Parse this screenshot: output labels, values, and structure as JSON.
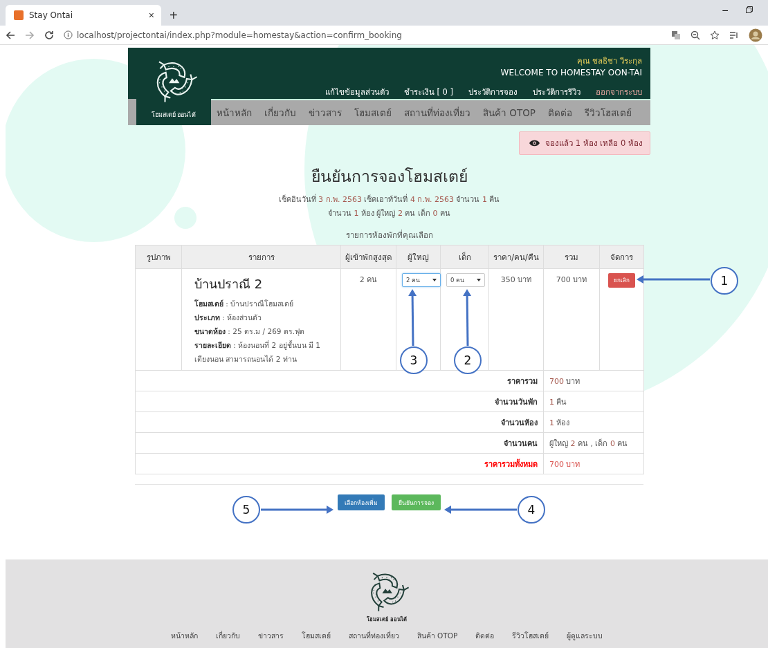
{
  "browser": {
    "tab_title": "Stay Ontai",
    "tab_close": "×",
    "new_tab": "+",
    "address": "localhost/projectontai/index.php?module=homestay&action=confirm_booking",
    "minimize": "–"
  },
  "header": {
    "user": "คุณ ชลธิชา วีระกุล",
    "welcome": "WELCOME TO HOMESTAY OON-TAI",
    "logo_text": "โฮมสเตย์ ออนไต้",
    "top_links": [
      {
        "label": "แก้ไขข้อมูลส่วนตัว",
        "kind": "normal"
      },
      {
        "label": "ชำระเงิน [ 0 ]",
        "kind": "normal"
      },
      {
        "label": "ประวัติการจอง",
        "kind": "normal"
      },
      {
        "label": "ประวัติการรีวิว",
        "kind": "normal"
      },
      {
        "label": "ออกจากระบบ",
        "kind": "logout"
      }
    ],
    "nav": [
      "หน้าหลัก",
      "เกี่ยวกับ",
      "ข่าวสาร",
      "โฮมสเตย์",
      "สถานที่ท่องเที่ยว",
      "สินค้า OTOP",
      "ติดต่อ",
      "รีวิวโฮสเตย์"
    ]
  },
  "alert": "จองแล้ว 1 ห้อง เหลือ 0 ห้อง",
  "title": "ยืนยันการจองโฮมสเตย์",
  "summary_lines": [
    [
      {
        "text": "เช็คอินวันที่ ",
        "highlight": false
      },
      {
        "text": "3 ก.พ. 2563",
        "highlight": true
      },
      {
        "text": " เช็คเอาท์วันที่ ",
        "highlight": false
      },
      {
        "text": "4 ก.พ. 2563",
        "highlight": true
      },
      {
        "text": " จำนวน ",
        "highlight": false
      },
      {
        "text": "1",
        "highlight": true
      },
      {
        "text": " คืน",
        "highlight": false
      }
    ],
    [
      {
        "text": "จำนวน ",
        "highlight": false
      },
      {
        "text": "1",
        "highlight": true
      },
      {
        "text": " ห้อง ผู้ใหญ่ ",
        "highlight": false
      },
      {
        "text": "2",
        "highlight": true
      },
      {
        "text": " คน เด็ก ",
        "highlight": false
      },
      {
        "text": "0",
        "highlight": true
      },
      {
        "text": " คน",
        "highlight": false
      }
    ]
  ],
  "table_caption": "รายการห้องพักที่คุณเลือก",
  "table": {
    "columns": [
      "รูปภาพ",
      "รายการ",
      "ผู้เข้าพักสูงสุด",
      "ผู้ใหญ่",
      "เด็ก",
      "ราคา/คน/คืน",
      "รวม",
      "จัดการ"
    ],
    "rows": [
      {
        "room": "บ้านปราณี 2",
        "details": [
          "**โฮมสเตย์** : บ้านปราณีโฮมสเตย์",
          "**ประเภท** : ห้องส่วนตัว",
          "**ขนาดห้อง** : 25 ตร.ม / 269 ตร.ฟุต",
          "**รายละเอียด** : ห้องนอนที่ 2 อยู่ชั้นบน มี 1 เตียงนอน สามารถนอนได้ 2 ท่าน"
        ],
        "max_guests": "2 คน",
        "adults": "2 คน",
        "children": "0 คน",
        "price": "350 บาท",
        "total": "700 บาท",
        "cancel": "ยกเลิก"
      }
    ],
    "totals": [
      {
        "label": "ราคารวม",
        "kind": "normal",
        "value": [
          {
            "text": "700",
            "highlight": true
          },
          {
            "text": " บาท",
            "highlight": false
          }
        ]
      },
      {
        "label": "จำนวนวันพัก",
        "kind": "normal",
        "value": [
          {
            "text": "1",
            "highlight": true
          },
          {
            "text": " คืน",
            "highlight": false
          }
        ]
      },
      {
        "label": "จำนวนห้อง",
        "kind": "normal",
        "value": [
          {
            "text": "1",
            "highlight": true
          },
          {
            "text": " ห้อง",
            "highlight": false
          }
        ]
      },
      {
        "label": "จำนวนคน",
        "kind": "normal",
        "value": [
          {
            "text": "ผู้ใหญ่ ",
            "highlight": false
          },
          {
            "text": "2",
            "highlight": true
          },
          {
            "text": " คน , เด็ก ",
            "highlight": false
          },
          {
            "text": "0",
            "highlight": true
          },
          {
            "text": " คน",
            "highlight": false
          }
        ]
      },
      {
        "label": "ราคารวมทั้งหมด",
        "kind": "grand",
        "value": [
          {
            "text": "700 บาท",
            "highlight": true
          }
        ]
      }
    ]
  },
  "buttons": [
    {
      "label": "เลือกห้องเพิ่ม",
      "kind": "primary"
    },
    {
      "label": "ยืนยันการจอง",
      "kind": "success"
    }
  ],
  "callouts": [
    "1",
    "3",
    "2",
    "5",
    "4"
  ],
  "footer": {
    "logo_text": "โฮมสเตย์ ออนไต้",
    "links": [
      "หน้าหลัก",
      "เกี่ยวกับ",
      "ข่าวสาร",
      "โฮมสเตย์",
      "สถานที่ท่องเที่ยว",
      "สินค้า OTOP",
      "ติดต่อ",
      "รีวิวโฮสเตย์",
      "ผู้ดูแลระบบ"
    ]
  }
}
